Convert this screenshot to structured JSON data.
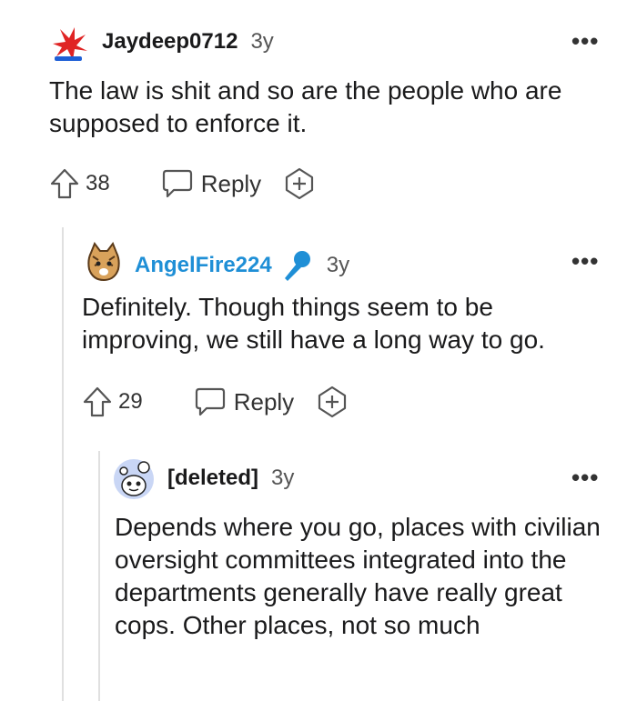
{
  "comments": [
    {
      "username": "Jaydeep0712",
      "age": "3y",
      "text": "The law is shit and so are the people who are supposed to enforce it.",
      "votes": "38",
      "reply_label": "Reply",
      "avatar": "red-brush-logo-avatar"
    },
    {
      "username": "AngelFire224",
      "age": "3y",
      "text": "Definitely. Though things seem to be improving, we still have a long way to go.",
      "votes": "29",
      "reply_label": "Reply",
      "avatar": "cat-avatar",
      "badge_icon": "microphone-icon",
      "username_color": "#1f8fd6"
    },
    {
      "username": "[deleted]",
      "age": "3y",
      "text": "Depends where you go, places with civilian oversight committees integrated into the departments generally have really great cops. Other places, not so much",
      "avatar": "snoo-avatar"
    }
  ],
  "more_label": "•••",
  "colors": {
    "text": "#1a1a1b",
    "accent": "#1f8fd6",
    "muted": "#555555",
    "thread_line": "#e0e0e0"
  }
}
